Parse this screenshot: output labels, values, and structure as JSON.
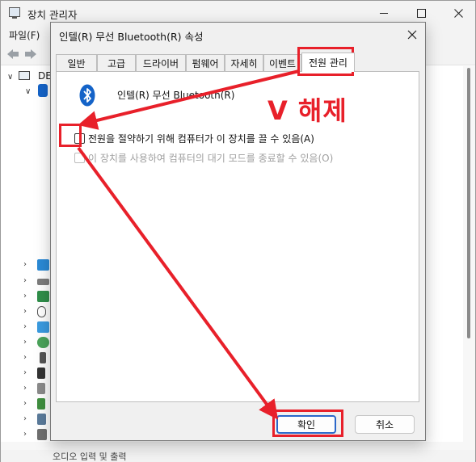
{
  "background_window": {
    "title": "장치 관리자",
    "menu": [
      "파일(F)"
    ],
    "tree_root_label": "DE",
    "status_text": "오디오 입력 및 출력"
  },
  "dialog": {
    "title": "인텔(R) 무선 Bluetooth(R) 속성",
    "tabs": [
      {
        "label": "일반"
      },
      {
        "label": "고급"
      },
      {
        "label": "드라이버"
      },
      {
        "label": "펌웨어"
      },
      {
        "label": "자세히"
      },
      {
        "label": "이벤트"
      },
      {
        "label": "전원 관리",
        "active": true
      }
    ],
    "device_name": "인텔(R) 무선 Bluetooth(R)",
    "options": [
      {
        "label": "전원을 절약하기 위해 컴퓨터가 이 장치를 끌 수 있음(A)",
        "checked": false,
        "enabled": true
      },
      {
        "label": "이 장치를 사용하여 컴퓨터의 대기 모드를 종료할 수 있음(O)",
        "checked": false,
        "enabled": false
      }
    ],
    "ok_label": "확인",
    "cancel_label": "취소"
  },
  "annotation": {
    "text": "V 해제",
    "color": "#e8202a"
  },
  "colors": {
    "bluetooth_blue": "#1463c8",
    "annotation_red": "#e8202a"
  }
}
